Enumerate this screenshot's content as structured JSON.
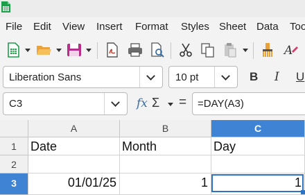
{
  "menubar": {
    "items": [
      "File",
      "Edit",
      "View",
      "Insert",
      "Format",
      "Styles",
      "Sheet",
      "Data",
      "Too"
    ]
  },
  "toolbar": {
    "icons": [
      "new-spreadsheet-icon",
      "open-folder-icon",
      "save-icon",
      "export-pdf-icon",
      "print-icon",
      "print-preview-icon",
      "cut-icon",
      "copy-icon",
      "paste-icon",
      "clone-formatting-icon",
      "clear-formatting-icon"
    ]
  },
  "format_bar": {
    "font_name": "Liberation Sans",
    "font_size": "10 pt",
    "bold": "B",
    "italic": "I",
    "underline": "U"
  },
  "formula_bar": {
    "name_box": "C3",
    "fx": "fx",
    "sigma": "Σ",
    "equals": "=",
    "formula": "=DAY(A3)"
  },
  "sheet": {
    "columns": [
      "A",
      "B",
      "C"
    ],
    "active_column": "C",
    "rows": [
      {
        "header": "1",
        "cells": [
          "Date",
          "Month",
          "Day"
        ]
      },
      {
        "header": "2",
        "cells": [
          "",
          "",
          ""
        ]
      },
      {
        "header": "3",
        "cells": [
          "01/01/25",
          "1",
          "1"
        ]
      }
    ],
    "active_row": "3",
    "active_cell": "C3"
  },
  "colors": {
    "accent": "#3f84d4",
    "menubar_bg": "#f3f3f3",
    "header_bg": "#f0f0f0"
  }
}
